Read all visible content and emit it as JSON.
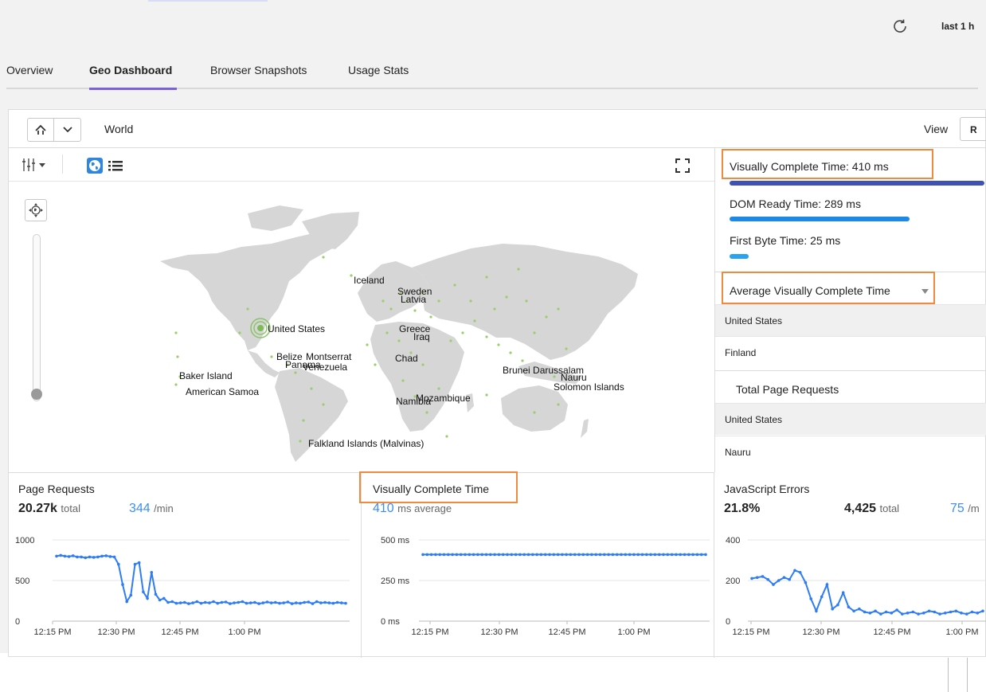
{
  "header": {
    "time_range": "last 1 h"
  },
  "tabs": [
    {
      "label": "Overview"
    },
    {
      "label": "Geo Dashboard"
    },
    {
      "label": "Browser Snapshots"
    },
    {
      "label": "Usage Stats"
    }
  ],
  "breadcrumb": {
    "title": "World",
    "view_label": "View",
    "view_value": "R"
  },
  "map": {
    "labels": {
      "iceland": "Iceland",
      "sweden": "Sweden",
      "latvia": "Latvia",
      "united_states": "United States",
      "greece": "Greece",
      "iraq": "Iraq",
      "belize": "Belize",
      "montserrat": "Montserrat",
      "panama": "Panama",
      "venezuela": "Venezuela",
      "chad": "Chad",
      "brunei": "Brunei Darussalam",
      "nauru": "Nauru",
      "solomon": "Solomon Islands",
      "baker": "Baker Island",
      "samoa": "American Samoa",
      "namibia": "Namibia",
      "mozambique": "Mozambique",
      "falkland": "Falkland Islands (Malvinas)"
    }
  },
  "side_panel": {
    "metrics": [
      {
        "label": "Visually Complete Time: 410 ms",
        "value": 410,
        "color": "#3f51b5"
      },
      {
        "label": "DOM Ready Time: 289 ms",
        "value": 289,
        "color": "#1e88e5"
      },
      {
        "label": "First Byte Time: 25 ms",
        "value": 25,
        "color": "#29a3f0"
      }
    ],
    "avg_vct": {
      "title": "Average Visually Complete Time",
      "rows": [
        "United States",
        "Finland"
      ]
    },
    "total_requests": {
      "title": "Total Page Requests",
      "rows": [
        "United States",
        "Nauru"
      ]
    }
  },
  "widgets": {
    "page_requests": {
      "title": "Page Requests",
      "total": "20.27k",
      "total_unit": "total",
      "rate": "344",
      "rate_unit": "/min"
    },
    "vct": {
      "title": "Visually Complete Time",
      "avg": "410",
      "avg_unit": "ms average"
    },
    "js_errors": {
      "title": "JavaScript Errors",
      "pct": "21.8%",
      "total": "4,425",
      "total_unit": "total",
      "rate": "75",
      "rate_unit": "/m"
    }
  },
  "colors": {
    "accent": "#7b61d8",
    "highlight": "#f08a3e",
    "series": "#2e7cf6"
  },
  "chart_data": [
    {
      "type": "line",
      "title": "Page Requests",
      "ylim": [
        0,
        1000
      ],
      "yticks": [
        "1000",
        "500",
        "0"
      ],
      "xticks": [
        "12:15 PM",
        "12:30 PM",
        "12:45 PM",
        "1:00 PM"
      ],
      "series": [
        {
          "values": [
            800,
            810,
            800,
            795,
            805,
            790,
            790,
            780,
            790,
            785,
            790,
            800,
            805,
            795,
            790,
            700,
            450,
            240,
            320,
            700,
            720,
            360,
            280,
            600,
            330,
            260,
            280,
            230,
            240,
            220,
            225,
            230,
            215,
            225,
            240,
            220,
            230,
            225,
            240,
            220,
            230,
            235,
            215,
            225,
            230,
            240,
            220,
            225,
            230,
            215,
            225,
            235,
            225,
            230,
            220,
            225,
            235,
            215,
            225,
            220,
            230,
            235,
            215,
            240,
            225,
            230,
            225,
            220,
            230,
            225,
            220
          ]
        }
      ]
    },
    {
      "type": "line",
      "title": "Visually Complete Time",
      "ylim": [
        0,
        500
      ],
      "yticks": [
        "500 ms",
        "250 ms",
        "0 ms"
      ],
      "xticks": [
        "12:15 PM",
        "12:30 PM",
        "12:45 PM",
        "1:00 PM"
      ],
      "series": [
        {
          "values": [
            410,
            410,
            410,
            410,
            410,
            410,
            410,
            410,
            410,
            410,
            410,
            410,
            410,
            410,
            410,
            410,
            410,
            410,
            410,
            410,
            410,
            410,
            410,
            410,
            410,
            410,
            410,
            410,
            410,
            410,
            410,
            410,
            410,
            410,
            410,
            410,
            410,
            410,
            410,
            410,
            410,
            410,
            410,
            410,
            410,
            410,
            410,
            410,
            410,
            410,
            410,
            410,
            410,
            410,
            410,
            410,
            410,
            410,
            410,
            410,
            410,
            410,
            410,
            410,
            410,
            410,
            410,
            410
          ]
        }
      ]
    },
    {
      "type": "line",
      "title": "JavaScript Errors",
      "ylim": [
        0,
        400
      ],
      "yticks": [
        "400",
        "200",
        "0"
      ],
      "xticks": [
        "12:15 PM",
        "12:30 PM",
        "12:45 PM",
        "1:00 PM"
      ],
      "series": [
        {
          "values": [
            210,
            215,
            220,
            205,
            180,
            200,
            215,
            205,
            250,
            240,
            190,
            110,
            50,
            120,
            180,
            60,
            80,
            140,
            70,
            50,
            60,
            45,
            40,
            50,
            35,
            45,
            40,
            55,
            35,
            40,
            45,
            35,
            40,
            50,
            45,
            35,
            40,
            45,
            50,
            40,
            35,
            45,
            40,
            50
          ]
        }
      ]
    }
  ]
}
